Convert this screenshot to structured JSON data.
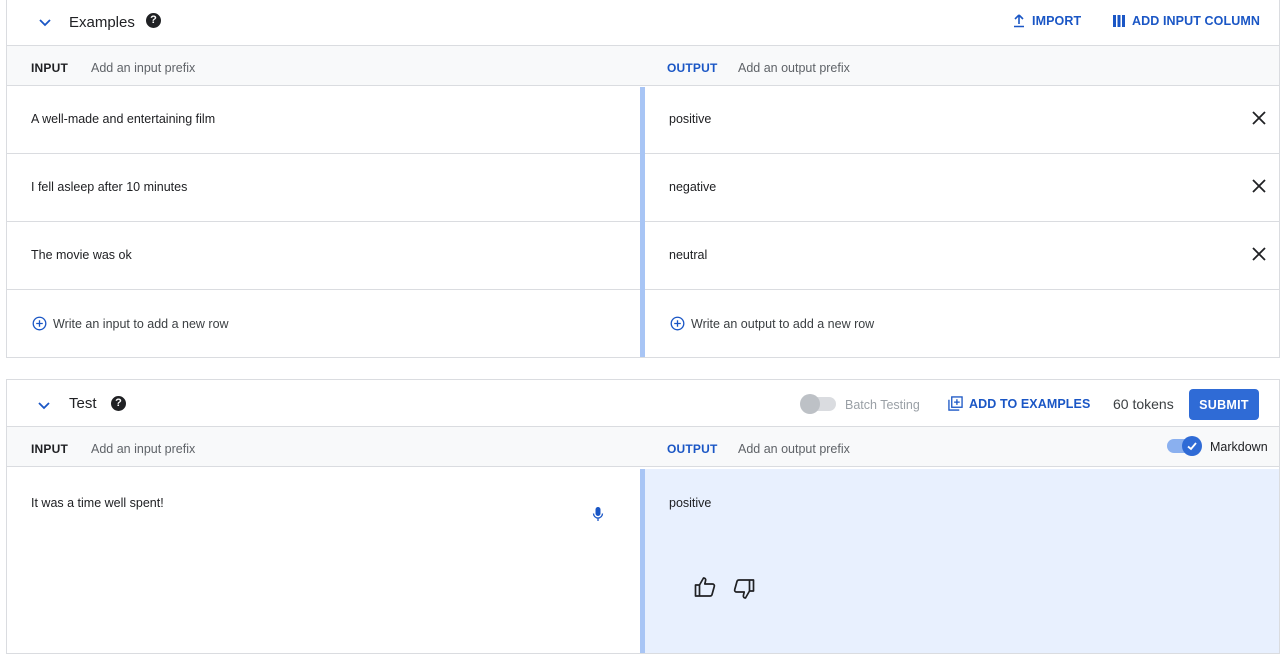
{
  "examples": {
    "title": "Examples",
    "help_icon": "?",
    "import_label": "IMPORT",
    "add_column_label": "ADD INPUT COLUMN",
    "input_header": "INPUT",
    "input_prefix_placeholder": "Add an input prefix",
    "output_header": "OUTPUT",
    "output_prefix_placeholder": "Add an output prefix",
    "rows": [
      {
        "input": "A well-made and entertaining film",
        "output": "positive"
      },
      {
        "input": "I fell asleep after 10 minutes",
        "output": "negative"
      },
      {
        "input": "The movie was ok",
        "output": "neutral"
      }
    ],
    "add_input_placeholder": "Write an input to add a new row",
    "add_output_placeholder": "Write an output to add a new row"
  },
  "test": {
    "title": "Test",
    "help_icon": "?",
    "batch_testing_label": "Batch Testing",
    "batch_testing_on": false,
    "add_to_examples_label": "ADD TO EXAMPLES",
    "tokens_label": "60 tokens",
    "submit_label": "SUBMIT",
    "input_header": "INPUT",
    "input_prefix_placeholder": "Add an input prefix",
    "output_header": "OUTPUT",
    "output_prefix_placeholder": "Add an output prefix",
    "markdown_label": "Markdown",
    "markdown_on": true,
    "input_value": "It was a time well spent!",
    "output_value": "positive"
  },
  "colors": {
    "accent": "#2f6bd6",
    "link": "#1a56c5",
    "divider": "#a8c5f5",
    "output_bg": "#e8f0fe"
  },
  "icons": {
    "collapse": "chevron-down-icon",
    "import": "upload-icon",
    "add_column": "columns-icon",
    "remove_row": "close-icon",
    "add_row": "add-circle-icon",
    "add_to_examples": "library-add-icon",
    "mic": "mic-icon",
    "thumbs_up": "thumb-up-icon",
    "thumbs_down": "thumb-down-icon"
  }
}
